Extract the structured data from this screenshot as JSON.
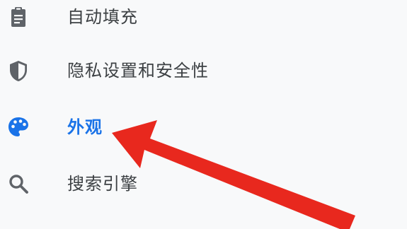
{
  "settings_menu": {
    "items": [
      {
        "label": "自动填充",
        "icon": "clipboard-icon"
      },
      {
        "label": "隐私设置和安全性",
        "icon": "shield-icon"
      },
      {
        "label": "外观",
        "icon": "palette-icon",
        "selected": true
      },
      {
        "label": "搜索引擎",
        "icon": "search-icon"
      }
    ]
  },
  "colors": {
    "selected_text": "#1a73e8",
    "default_text": "#3c4043",
    "icon_default": "#5f6368",
    "arrow": "#e8281e"
  }
}
